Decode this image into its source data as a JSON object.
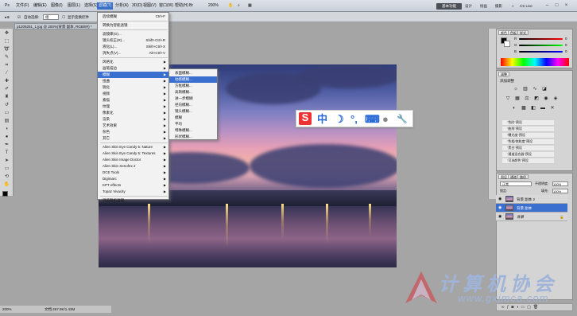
{
  "menubar": {
    "items": [
      "文件(F)",
      "编辑(E)",
      "图像(I)",
      "图层(L)",
      "选择(S)",
      "滤镜(T)",
      "分析(A)",
      "3D(D)",
      "视图(V)",
      "窗口(W)",
      "帮助(H)"
    ],
    "zoom": "200%",
    "workspace_active": "基本功能",
    "workspaces": [
      "设计",
      "绘画",
      "摄影"
    ],
    "cslive": "CS Live"
  },
  "options": {
    "auto_select_label": "自动选择:",
    "auto_select_value": "组",
    "transform_label": "显示变换控件"
  },
  "document": {
    "tab_title": "p1205251_1.jpg @ 200%(背景 副本, RGB/8#) *",
    "status_zoom": "200%",
    "status_doc": "文档:467.9K/1.43M"
  },
  "filter_menu": {
    "items": [
      {
        "label": "后续模糊",
        "shortcut": "Ctrl+F"
      },
      {
        "sep": true
      },
      {
        "label": "转换为智能滤镜"
      },
      {
        "sep": true
      },
      {
        "label": "滤镜库(G)..."
      },
      {
        "label": "镜头校正(R)...",
        "shortcut": "Shift+Ctrl+R"
      },
      {
        "label": "液化(L)...",
        "shortcut": "Shift+Ctrl+X"
      },
      {
        "label": "消失点(V)...",
        "shortcut": "Alt+Ctrl+V"
      },
      {
        "sep": true
      },
      {
        "label": "风格化",
        "arrow": true
      },
      {
        "label": "画笔描边",
        "arrow": true
      },
      {
        "label": "模糊",
        "arrow": true,
        "highlight": true
      },
      {
        "label": "扭曲",
        "arrow": true
      },
      {
        "label": "锐化",
        "arrow": true
      },
      {
        "label": "视频",
        "arrow": true
      },
      {
        "label": "素描",
        "arrow": true
      },
      {
        "label": "纹理",
        "arrow": true
      },
      {
        "label": "像素化",
        "arrow": true
      },
      {
        "label": "渲染",
        "arrow": true
      },
      {
        "label": "艺术效果",
        "arrow": true
      },
      {
        "label": "杂色",
        "arrow": true
      },
      {
        "label": "其它",
        "arrow": true
      },
      {
        "sep": true
      },
      {
        "label": "Alien Skin Eye Candy 5: Nature",
        "arrow": true
      },
      {
        "label": "Alien Skin Eye Candy 5: Textures",
        "arrow": true
      },
      {
        "label": "Alien Skin Image Doctor",
        "arrow": true
      },
      {
        "label": "Alien Skin Xenofex 2",
        "arrow": true
      },
      {
        "label": "DCE Tools",
        "arrow": true
      },
      {
        "label": "Digimarc",
        "arrow": true
      },
      {
        "label": "KPT effects",
        "arrow": true
      },
      {
        "label": "Topaz Vivacity",
        "arrow": true
      },
      {
        "sep": true
      },
      {
        "label": "浏览联机滤镜..."
      }
    ]
  },
  "blur_submenu": {
    "items": [
      "表面模糊...",
      "动感模糊...",
      "方框模糊...",
      "高斯模糊...",
      "进一步模糊",
      "径向模糊...",
      "镜头模糊...",
      "模糊",
      "平均",
      "特殊模糊...",
      "形状模糊..."
    ],
    "highlight_index": 1
  },
  "ime": {
    "logo": "S",
    "mode": "中",
    "moon": "☽",
    "punct": "°,",
    "keyboard": "⌨",
    "user": "●",
    "tool": "🔧"
  },
  "panels": {
    "color_tabs": [
      "颜色",
      "色板",
      "样式"
    ],
    "channels": [
      "R",
      "G",
      "B"
    ],
    "channel_values": [
      "0",
      "0",
      "0"
    ],
    "adjust_tab": "调整",
    "adjust_title": "添加调整",
    "presets": [
      "\"色阶\"预设",
      "\"曲线\"预设",
      "\"曝光度\"预设",
      "\"色相/饱和度\"预设",
      "\"黑白\"预设",
      "\"通道混合器\"预设",
      "\"可选颜色\"预设"
    ],
    "layer_tabs": [
      "图层",
      "通道",
      "路径"
    ],
    "blend_mode": "正常",
    "opacity_label": "不透明度:",
    "opacity": "100%",
    "lock_label": "锁定:",
    "fill_label": "填充:",
    "fill": "100%",
    "layers": [
      {
        "name": "背景 副本 2",
        "selected": false
      },
      {
        "name": "背景 副本",
        "selected": true
      },
      {
        "name": "背景",
        "selected": false
      }
    ]
  },
  "watermark": {
    "title": "计算机协会",
    "url": "www.gxjmca.com"
  }
}
